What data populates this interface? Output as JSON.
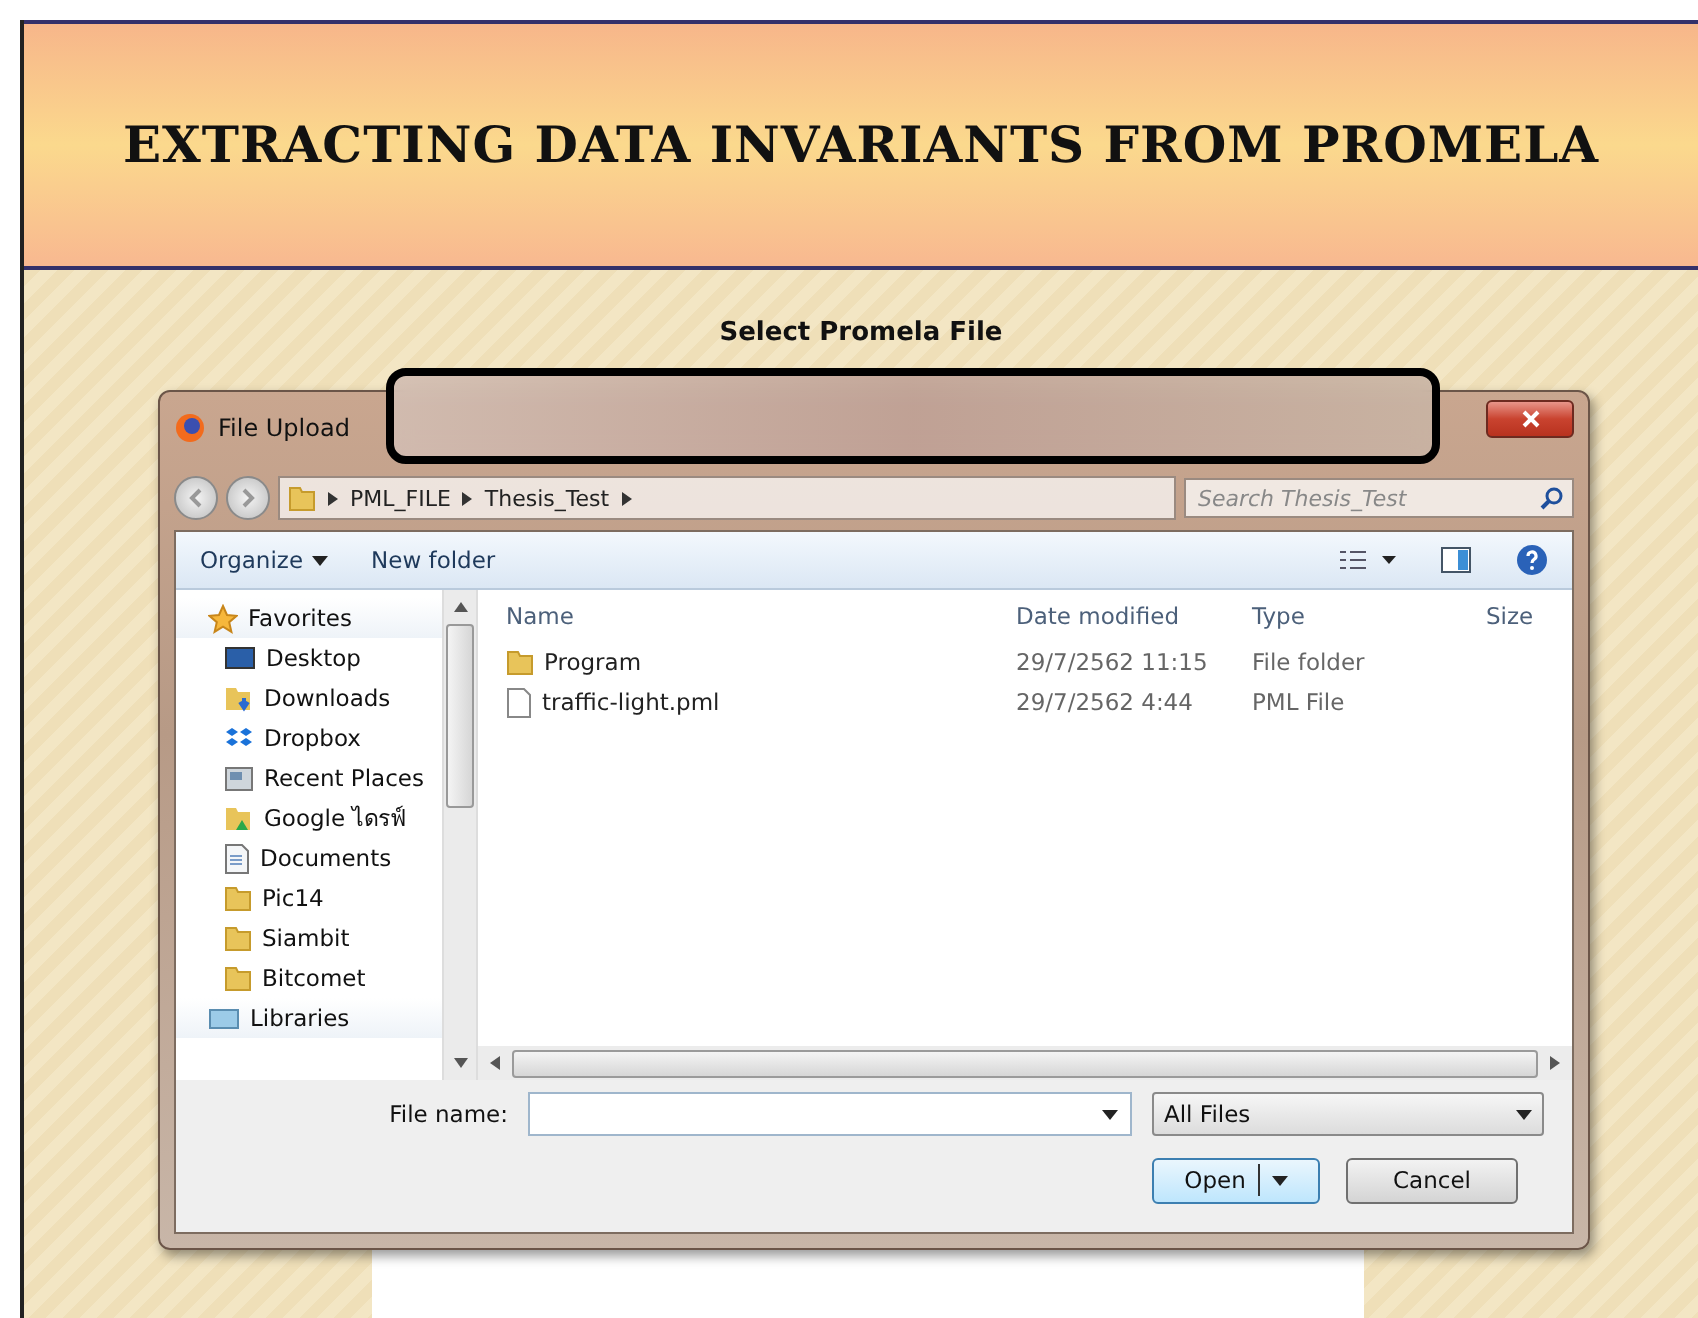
{
  "banner": {
    "title": "EXTRACTING DATA INVARIANTS FROM PROMELA"
  },
  "heading": "Select Promela File",
  "dialog": {
    "title": "File Upload",
    "breadcrumbs": [
      "PML_FILE",
      "Thesis_Test"
    ],
    "search": {
      "placeholder": "Search Thesis_Test"
    },
    "toolbar": [
      {
        "label": "Organize",
        "dropdown": true
      },
      {
        "label": "New folder",
        "dropdown": false
      }
    ],
    "nav": [
      {
        "label": "Favorites",
        "kind": "star"
      },
      {
        "label": "Desktop",
        "kind": "desktop"
      },
      {
        "label": "Downloads",
        "kind": "downloads"
      },
      {
        "label": "Dropbox",
        "kind": "dropbox"
      },
      {
        "label": "Recent Places",
        "kind": "recent"
      },
      {
        "label": "Google ไดรฟ์",
        "kind": "drive"
      },
      {
        "label": "Documents",
        "kind": "documents"
      },
      {
        "label": "Pic14",
        "kind": "folder"
      },
      {
        "label": "Siambit",
        "kind": "folder"
      },
      {
        "label": "Bitcomet",
        "kind": "folder"
      },
      {
        "label": "Libraries",
        "kind": "libraries"
      }
    ],
    "columns": [
      "Name",
      "Date modified",
      "Type",
      "Size"
    ],
    "files": [
      {
        "name": "Program",
        "date": "29/7/2562 11:15",
        "type": "File folder",
        "kind": "folder"
      },
      {
        "name": "traffic-light.pml",
        "date": "29/7/2562 4:44",
        "type": "PML File",
        "kind": "file"
      }
    ],
    "file_name": {
      "label": "File name:"
    },
    "filter": "All Files",
    "buttons": [
      "Open",
      "Cancel"
    ]
  }
}
